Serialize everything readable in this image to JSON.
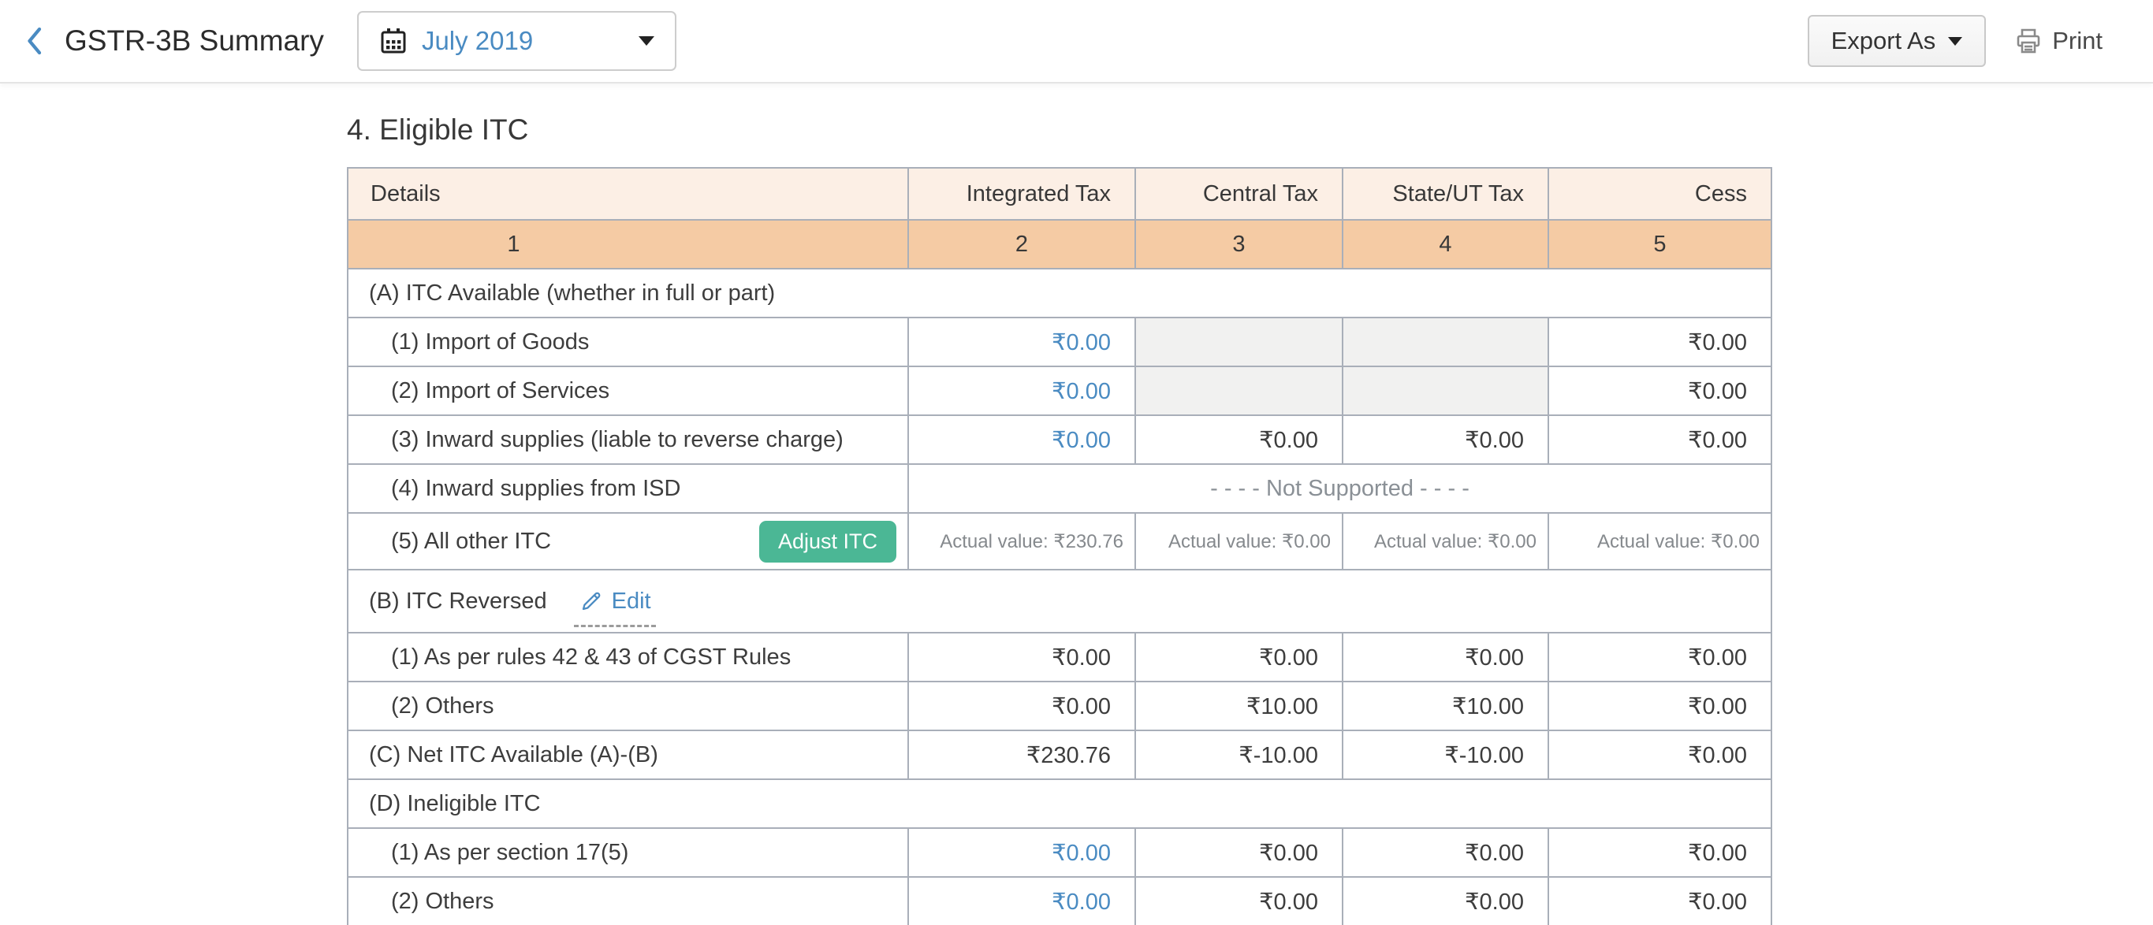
{
  "topbar": {
    "title": "GSTR-3B Summary",
    "back_icon": "chevron-left",
    "period_selector": {
      "icon": "calendar",
      "value": "July 2019"
    },
    "export_button": {
      "label": "Export As"
    },
    "print_button": {
      "icon": "printer",
      "label": "Print"
    }
  },
  "section_title": "4. Eligible ITC",
  "colors": {
    "accent_blue": "#4a8bc2",
    "header_peach_light": "#fcefe5",
    "header_peach_dark": "#f5cba4",
    "disabled_cell": "#f1f1f0",
    "adjust_button_green": "#4bb795",
    "table_border": "#a9afb9"
  },
  "table": {
    "columns": [
      {
        "label": "Details",
        "num": "1"
      },
      {
        "label": "Integrated Tax",
        "num": "2"
      },
      {
        "label": "Central Tax",
        "num": "3"
      },
      {
        "label": "State/UT Tax",
        "num": "4"
      },
      {
        "label": "Cess",
        "num": "5"
      }
    ],
    "rows": [
      {
        "type": "section",
        "label": "(A) ITC Available (whether in full or part)"
      },
      {
        "type": "item",
        "indent": true,
        "label": "(1) Import of Goods",
        "values": [
          {
            "text": "₹0.00",
            "variant": "link"
          },
          {
            "variant": "disabled"
          },
          {
            "variant": "disabled"
          },
          {
            "text": "₹0.00",
            "variant": "plain"
          }
        ]
      },
      {
        "type": "item",
        "indent": true,
        "label": "(2) Import of Services",
        "values": [
          {
            "text": "₹0.00",
            "variant": "link"
          },
          {
            "variant": "disabled"
          },
          {
            "variant": "disabled"
          },
          {
            "text": "₹0.00",
            "variant": "plain"
          }
        ]
      },
      {
        "type": "item",
        "indent": true,
        "label": "(3) Inward supplies (liable to reverse charge)",
        "values": [
          {
            "text": "₹0.00",
            "variant": "link"
          },
          {
            "text": "₹0.00",
            "variant": "plain"
          },
          {
            "text": "₹0.00",
            "variant": "plain"
          },
          {
            "text": "₹0.00",
            "variant": "plain"
          }
        ]
      },
      {
        "type": "span",
        "indent": true,
        "label": "(4) Inward supplies from ISD",
        "span_text": "- - - - Not Supported - - - -"
      },
      {
        "type": "item",
        "indent": true,
        "label": "(5) All other ITC",
        "button": "Adjust ITC",
        "values": [
          {
            "text": "Actual value: ₹230.76",
            "variant": "muted"
          },
          {
            "text": "Actual value: ₹0.00",
            "variant": "muted"
          },
          {
            "text": "Actual value: ₹0.00",
            "variant": "muted"
          },
          {
            "text": "Actual value: ₹0.00",
            "variant": "muted"
          }
        ]
      },
      {
        "type": "section",
        "label": "(B) ITC Reversed",
        "edit_label": "Edit"
      },
      {
        "type": "item",
        "indent": true,
        "label": "(1) As per rules 42 & 43 of CGST Rules",
        "values": [
          {
            "text": "₹0.00",
            "variant": "plain"
          },
          {
            "text": "₹0.00",
            "variant": "plain"
          },
          {
            "text": "₹0.00",
            "variant": "plain"
          },
          {
            "text": "₹0.00",
            "variant": "plain"
          }
        ]
      },
      {
        "type": "item",
        "indent": true,
        "label": "(2) Others",
        "values": [
          {
            "text": "₹0.00",
            "variant": "plain"
          },
          {
            "text": "₹10.00",
            "variant": "plain"
          },
          {
            "text": "₹10.00",
            "variant": "plain"
          },
          {
            "text": "₹0.00",
            "variant": "plain"
          }
        ]
      },
      {
        "type": "item",
        "indent": false,
        "label": "(C) Net ITC Available (A)-(B)",
        "values": [
          {
            "text": "₹230.76",
            "variant": "plain"
          },
          {
            "text": "₹-10.00",
            "variant": "plain"
          },
          {
            "text": "₹-10.00",
            "variant": "plain"
          },
          {
            "text": "₹0.00",
            "variant": "plain"
          }
        ]
      },
      {
        "type": "section",
        "label": "(D) Ineligible ITC"
      },
      {
        "type": "item",
        "indent": true,
        "label": "(1) As per section 17(5)",
        "values": [
          {
            "text": "₹0.00",
            "variant": "link"
          },
          {
            "text": "₹0.00",
            "variant": "plain"
          },
          {
            "text": "₹0.00",
            "variant": "plain"
          },
          {
            "text": "₹0.00",
            "variant": "plain"
          }
        ]
      },
      {
        "type": "item",
        "indent": true,
        "label": "(2) Others",
        "values": [
          {
            "text": "₹0.00",
            "variant": "link"
          },
          {
            "text": "₹0.00",
            "variant": "plain"
          },
          {
            "text": "₹0.00",
            "variant": "plain"
          },
          {
            "text": "₹0.00",
            "variant": "plain"
          }
        ]
      }
    ]
  }
}
